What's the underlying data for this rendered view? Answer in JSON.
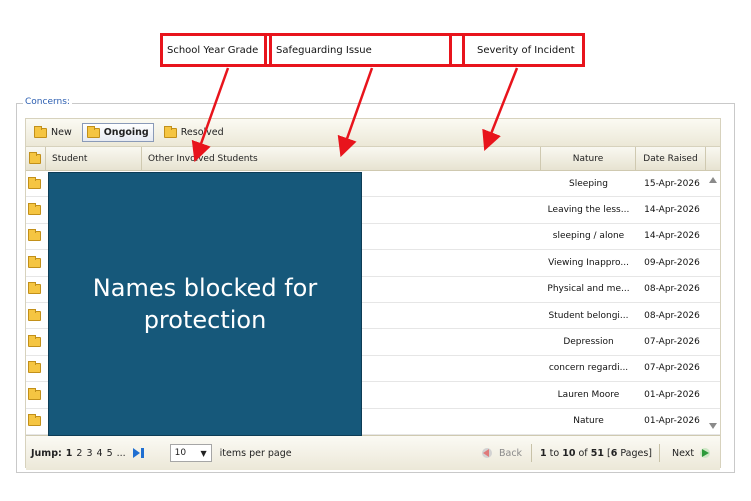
{
  "callouts": [
    {
      "label": "School Year Grade"
    },
    {
      "label": "Safeguarding Issue"
    },
    {
      "label": "Severity of Incident"
    }
  ],
  "panel": {
    "legend": "Concerns:"
  },
  "toolbar": {
    "new_label": "New",
    "ongoing_label": "Ongoing",
    "resolved_label": "Resolved"
  },
  "columns": {
    "student": "Student",
    "other": "Other Involved Students",
    "nature": "Nature",
    "date": "Date Raised"
  },
  "rows": [
    {
      "nature": "Sleeping",
      "date": "15-Apr-2026"
    },
    {
      "nature": "Leaving the less...",
      "date": "14-Apr-2026"
    },
    {
      "nature": "sleeping / alone",
      "date": "14-Apr-2026"
    },
    {
      "nature": "Viewing Inappro...",
      "date": "09-Apr-2026"
    },
    {
      "nature": "Physical and me...",
      "date": "08-Apr-2026"
    },
    {
      "nature": "Student belongi...",
      "date": "08-Apr-2026"
    },
    {
      "nature": "Depression",
      "date": "07-Apr-2026"
    },
    {
      "nature": "concern regardi...",
      "date": "07-Apr-2026"
    },
    {
      "nature": "Lauren Moore",
      "date": "01-Apr-2026"
    },
    {
      "nature": "Nature",
      "date": "01-Apr-2026"
    }
  ],
  "overlay": {
    "line1": "Names blocked for",
    "line2": "protection"
  },
  "pager": {
    "jump_label": "Jump:",
    "current_page": "1",
    "pages": [
      "2",
      "3",
      "4",
      "5"
    ],
    "ellipsis": "...",
    "page_size": "10",
    "items_per_page_label": "items per page",
    "back_label": "Back",
    "range_from": "1",
    "range_to_word": "to",
    "range_to": "10",
    "of_word": "of",
    "total": "51",
    "page_count": "6",
    "pages_word": "Pages",
    "next_label": "Next"
  },
  "colors": {
    "callout": "#e8141c",
    "overlay": "#16587a",
    "link": "#2a5db0"
  }
}
